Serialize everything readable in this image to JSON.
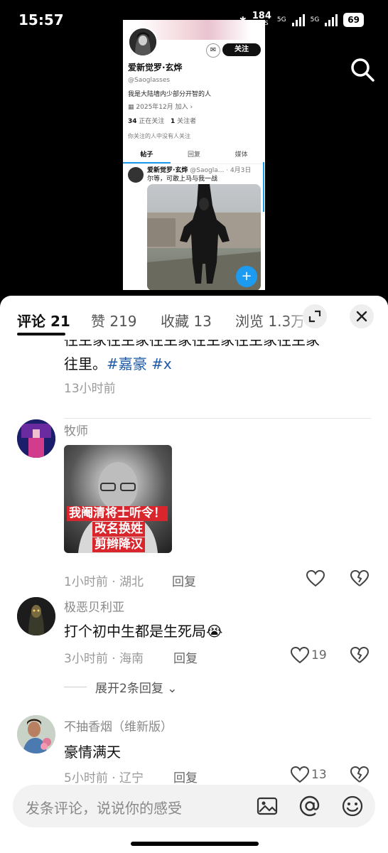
{
  "status_bar": {
    "time": "15:57",
    "net_speed_value": "184",
    "net_speed_unit": "KB/S",
    "net_1": "5G",
    "net_2": "5G",
    "battery": "69"
  },
  "preview": {
    "follow_label": "关注",
    "profile_name": "爱新觉罗·玄烨",
    "handle": "@Saoglasses",
    "bio": "我是大陆墙内少部分开智的人",
    "joined": "2025年12月 加入",
    "following_count": "34",
    "following_label": "正在关注",
    "followers_count": "1",
    "followers_label": "关注者",
    "no_common": "你关注的人中没有人关注",
    "tabs": [
      {
        "label": "帖子"
      },
      {
        "label": "回复"
      },
      {
        "label": "媒体"
      }
    ],
    "post": {
      "name": "爱新觉罗·玄烨",
      "handle": "@Saogla...",
      "date": "· 4月3日",
      "text": "尔等，可敢上马与我一战"
    },
    "fab": "+"
  },
  "sheet": {
    "tabs": {
      "comments": "评论 21",
      "likes": "赞 219",
      "favorites": "收藏 13",
      "views": "浏览 1.3万"
    }
  },
  "comments": [
    {
      "text_top": "往主家往主家往主家往主家往主家往主家",
      "text_line": "往里。",
      "tags": [
        "#嘉豪",
        "#x"
      ],
      "time": "13小时前"
    },
    {
      "user": "牧师",
      "image_text": [
        "我阉清将士听令！",
        "改名换姓",
        "剪辫降汉"
      ],
      "time": "1小时前 · 湖北",
      "reply": "回复"
    },
    {
      "user": "极恶贝利亚",
      "text": "打个初中生都是生死局",
      "emoji": "😭",
      "time": "3小时前 · 海南",
      "reply": "回复",
      "likes": "19",
      "expand": "展开2条回复"
    },
    {
      "user": "不抽香烟（维新版）",
      "text": "豪情满天",
      "time": "5小时前 · 辽宁",
      "reply": "回复",
      "likes": "13"
    }
  ],
  "input": {
    "placeholder": "发条评论，说说你的感受"
  }
}
